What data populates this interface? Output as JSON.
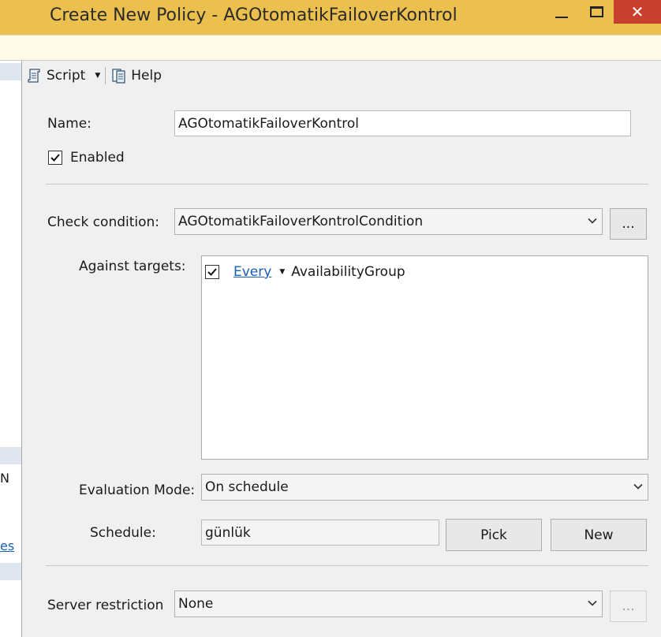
{
  "window": {
    "title": "Create New Policy - AGOtomatikFailoverKontrol",
    "close_glyph": "✕"
  },
  "left_pane": {
    "partial_text": "N",
    "partial_link": "es"
  },
  "toolbar": {
    "script_label": "Script",
    "help_label": "Help"
  },
  "form": {
    "name_label": "Name:",
    "name_value": "AGOtomatikFailoverKontrol",
    "enabled_label": "Enabled",
    "enabled_checked": true,
    "check_condition_label": "Check condition:",
    "check_condition_value": "AGOtomatikFailoverKontrolCondition",
    "ellipsis_label": "...",
    "against_targets_label": "Against targets:",
    "targets": [
      {
        "checked": true,
        "quantifier": "Every",
        "type": "AvailabilityGroup"
      }
    ],
    "evaluation_mode_label": "Evaluation Mode:",
    "evaluation_mode_value": "On schedule",
    "schedule_label": "Schedule:",
    "schedule_value": "günlük",
    "pick_label": "Pick",
    "new_label": "New",
    "server_restriction_label": "Server restriction",
    "server_restriction_value": "None",
    "server_restriction_ellipsis": "..."
  }
}
